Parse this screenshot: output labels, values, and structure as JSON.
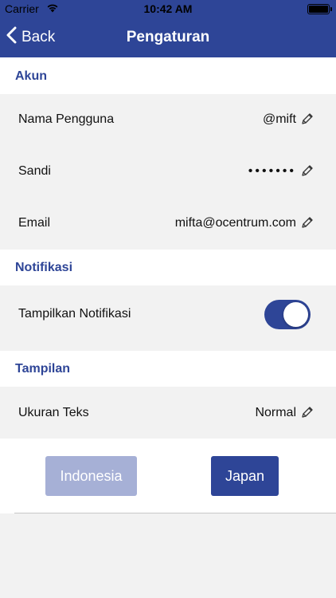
{
  "status_bar": {
    "carrier": "Carrier",
    "time": "10:42 AM"
  },
  "nav": {
    "back_label": "Back",
    "title": "Pengaturan"
  },
  "sections": {
    "akun": {
      "header": "Akun",
      "rows": [
        {
          "label": "Nama Pengguna",
          "value": "@mift"
        },
        {
          "label": "Sandi",
          "value": "•••••••"
        },
        {
          "label": "Email",
          "value": "mifta@ocentrum.com"
        }
      ]
    },
    "notifikasi": {
      "header": "Notifikasi",
      "toggle_label": "Tampilkan Notifikasi",
      "toggle_on": true
    },
    "tampilan": {
      "header": "Tampilan",
      "rows": [
        {
          "label": "Ukuran Teks",
          "value": "Normal"
        }
      ]
    }
  },
  "language_buttons": {
    "indonesia": "Indonesia",
    "japan": "Japan"
  },
  "colors": {
    "primary": "#2e4597",
    "primary_light": "#a6b0d6",
    "background": "#f2f2f2"
  }
}
